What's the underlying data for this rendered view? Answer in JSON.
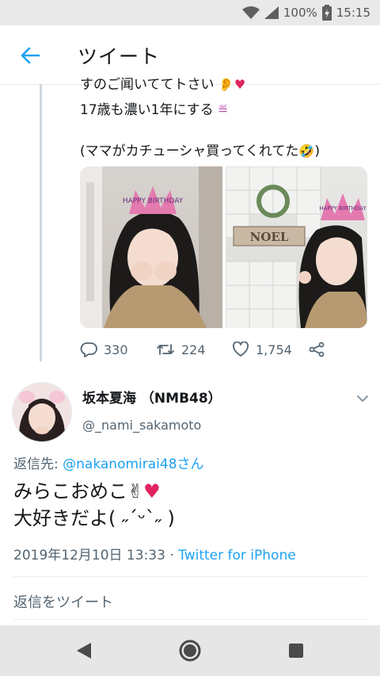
{
  "status_bar": {
    "battery": "100%",
    "time": "15:15"
  },
  "app_bar": {
    "title": "ツイート"
  },
  "previous_tweet": {
    "line1": "すのご闻いててトさい",
    "line2": "17歳も濃い1年にする",
    "line3": "(ママがカチューシャ買ってくれてた",
    "photos": [
      {
        "banner_text": "HAPPY BIRTHDAY"
      },
      {
        "banner_text": "HAPPY BIRTHDAY",
        "sign_text": "NOEL"
      }
    ],
    "actions": {
      "replies": "330",
      "retweets": "224",
      "likes": "1,754"
    }
  },
  "tweet": {
    "display_name": "坂本夏海 （NMB48）",
    "handle": "@_nami_sakamoto",
    "reply_to_label": "返信先: ",
    "reply_to_mention": "@nakanomirai48さん",
    "body_line1": "みらこおめこ",
    "body_line2": "大好きだよ( ˶ˊᵕˋ˶ )",
    "timestamp": "2019年12月10日 13:33 · ",
    "source": "Twitter for iPhone"
  },
  "reply_box": {
    "placeholder": "返信をツイート"
  },
  "colors": {
    "accent": "#1da1f2",
    "heart": "#e0245e",
    "muted": "#536471"
  }
}
